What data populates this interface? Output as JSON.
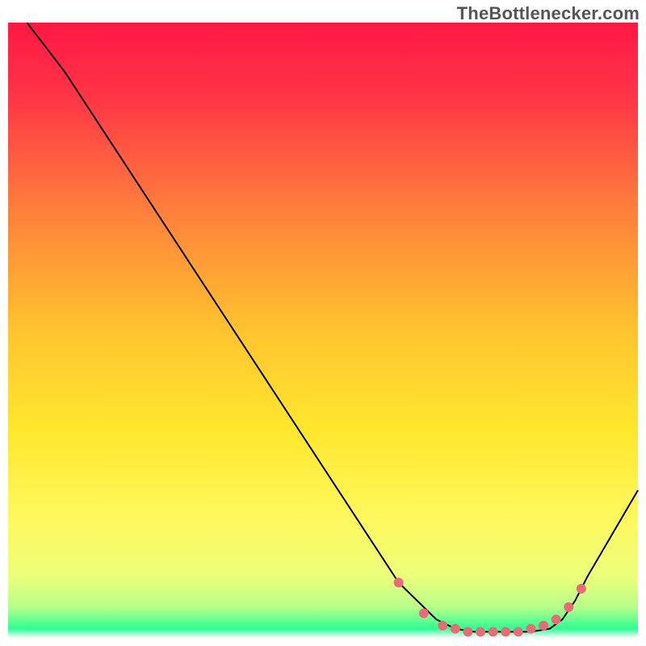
{
  "watermark": "TheBottlenecker.com",
  "chart_data": {
    "type": "line",
    "title": "",
    "xlabel": "",
    "ylabel": "",
    "xlim": [
      0,
      100
    ],
    "ylim": [
      0,
      100
    ],
    "grid": false,
    "legend": false,
    "background_gradient_stops": [
      {
        "offset": 0.0,
        "color": "#ff1744"
      },
      {
        "offset": 0.12,
        "color": "#ff3547"
      },
      {
        "offset": 0.3,
        "color": "#ff7d3c"
      },
      {
        "offset": 0.5,
        "color": "#ffc42e"
      },
      {
        "offset": 0.66,
        "color": "#ffe72d"
      },
      {
        "offset": 0.8,
        "color": "#fff85c"
      },
      {
        "offset": 0.9,
        "color": "#ecff7a"
      },
      {
        "offset": 0.95,
        "color": "#b6ff8a"
      },
      {
        "offset": 0.985,
        "color": "#2eff95"
      },
      {
        "offset": 1.0,
        "color": "#ffffff"
      }
    ],
    "series": [
      {
        "name": "bottleneck-curve",
        "x": [
          3,
          9,
          62,
          68,
          71,
          74,
          77,
          80,
          83,
          86,
          88,
          90,
          92,
          100
        ],
        "y": [
          100,
          92,
          9,
          3,
          1.5,
          1,
          1,
          1,
          1,
          1.5,
          3,
          6,
          10,
          24
        ],
        "stroke": "#000000",
        "stroke_width": 2
      }
    ],
    "markers": {
      "name": "highlighted-points",
      "x": [
        62,
        66,
        69,
        71,
        73,
        75,
        77,
        79,
        81,
        83,
        85,
        87,
        89,
        91
      ],
      "y": [
        9,
        4,
        2,
        1.5,
        1,
        1,
        1,
        1,
        1,
        1.5,
        2,
        3,
        5,
        8
      ],
      "radius": 6,
      "fill": "#e96b77"
    }
  }
}
